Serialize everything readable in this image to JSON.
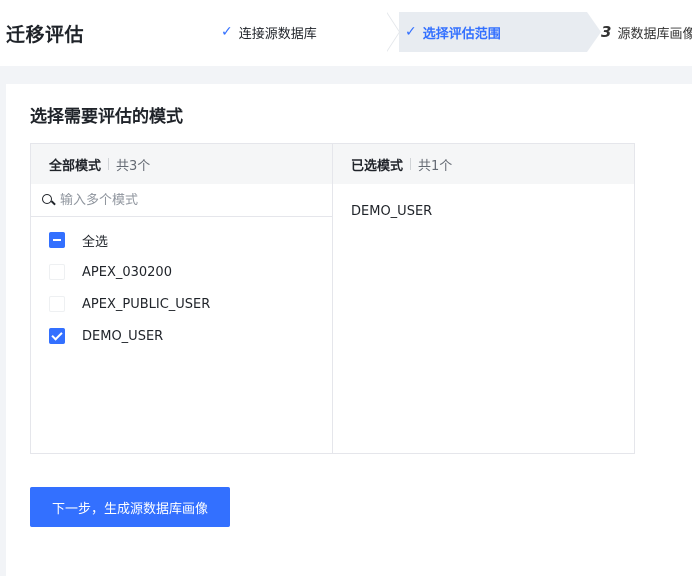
{
  "app_title": "迁移评估",
  "steps": [
    {
      "marker": "✓",
      "label": "连接源数据库",
      "state": "done"
    },
    {
      "marker": "✓",
      "label": "选择评估范围",
      "state": "active"
    },
    {
      "marker": "3",
      "label": "源数据库画像",
      "state": "pending"
    }
  ],
  "section_title": "选择需要评估的模式",
  "source_panel": {
    "title": "全部模式",
    "count": "共3个",
    "search_placeholder": "输入多个模式",
    "select_all_label": "全选",
    "items": [
      {
        "label": "APEX_030200",
        "checked": false
      },
      {
        "label": "APEX_PUBLIC_USER",
        "checked": false
      },
      {
        "label": "DEMO_USER",
        "checked": true
      }
    ]
  },
  "target_panel": {
    "title": "已选模式",
    "count": "共1个",
    "items": [
      "DEMO_USER"
    ]
  },
  "next_button_label": "下一步，生成源数据库画像",
  "colors": {
    "primary": "#3370ff",
    "active_step_bg": "#e8ecf1"
  }
}
